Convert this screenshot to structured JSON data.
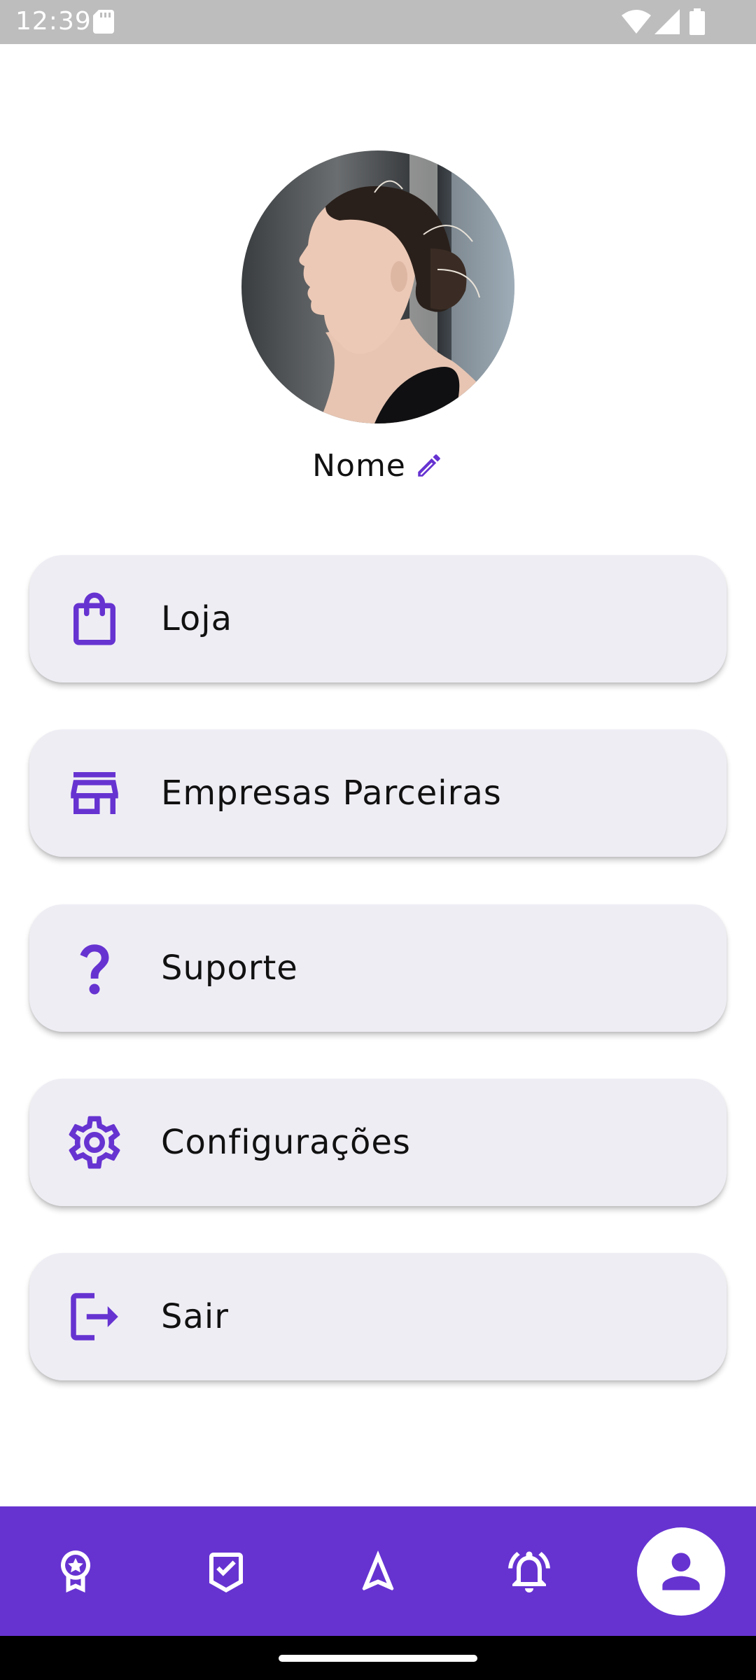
{
  "status_bar": {
    "time": "12:39",
    "icons": [
      "sd-card-icon",
      "wifi-icon",
      "cell-signal-icon",
      "battery-icon"
    ]
  },
  "profile": {
    "name": "Nome",
    "avatar": "avatar-photo",
    "edit_icon": "pencil-icon"
  },
  "menu": {
    "items": [
      {
        "label": "Loja",
        "icon": "shopping-bag-icon"
      },
      {
        "label": "Empresas Parceiras",
        "icon": "storefront-icon"
      },
      {
        "label": "Suporte",
        "icon": "question-mark-icon"
      },
      {
        "label": "Configurações",
        "icon": "gear-icon"
      },
      {
        "label": "Sair",
        "icon": "logout-icon"
      }
    ]
  },
  "bottom_nav": {
    "items": [
      {
        "icon": "award-ribbon-icon",
        "active": false
      },
      {
        "icon": "checkbox-icon",
        "active": false
      },
      {
        "icon": "navigation-arrow-icon",
        "active": false
      },
      {
        "icon": "notification-bell-icon",
        "active": false
      },
      {
        "icon": "person-icon",
        "active": true
      }
    ]
  },
  "colors": {
    "accent": "#6633d1",
    "card_background": "#efedf4",
    "status_bar": "#bdbdbd"
  }
}
